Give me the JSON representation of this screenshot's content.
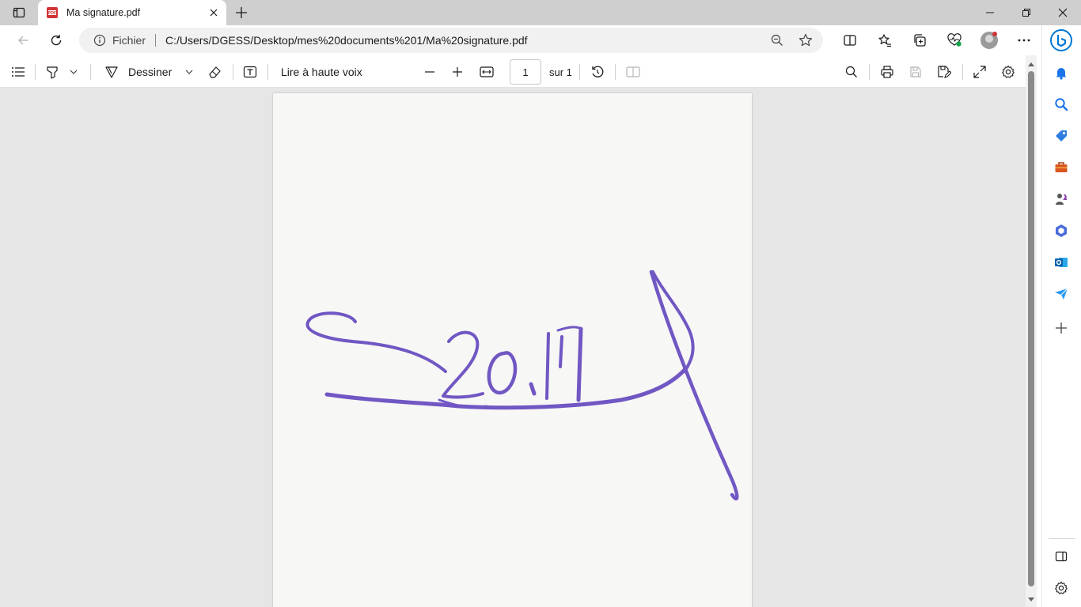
{
  "tab": {
    "title": "Ma signature.pdf",
    "icon": "pdf-icon",
    "close_icon": "close-icon"
  },
  "window_controls": [
    "minimize-icon",
    "restore-icon",
    "close-icon"
  ],
  "address": {
    "security_label": "Fichier",
    "url": "C:/Users/DGESS/Desktop/mes%20documents%201/Ma%20signature.pdf"
  },
  "pdf_toolbar": {
    "draw_label": "Dessiner",
    "read_aloud_label": "Lire à haute voix",
    "page_number": "1",
    "page_total_label": "sur 1"
  },
  "sidebar_items": [
    "bell-icon",
    "search-icon",
    "tag-icon",
    "toolbox-icon",
    "games-icon",
    "office-icon",
    "outlook-icon",
    "send-icon",
    "add-icon"
  ],
  "colors": {
    "ink": "#6a4fc1",
    "accent": "#0078d4",
    "tabstrip": "#cfcfcf",
    "doc_background": "#e6e6e6"
  }
}
